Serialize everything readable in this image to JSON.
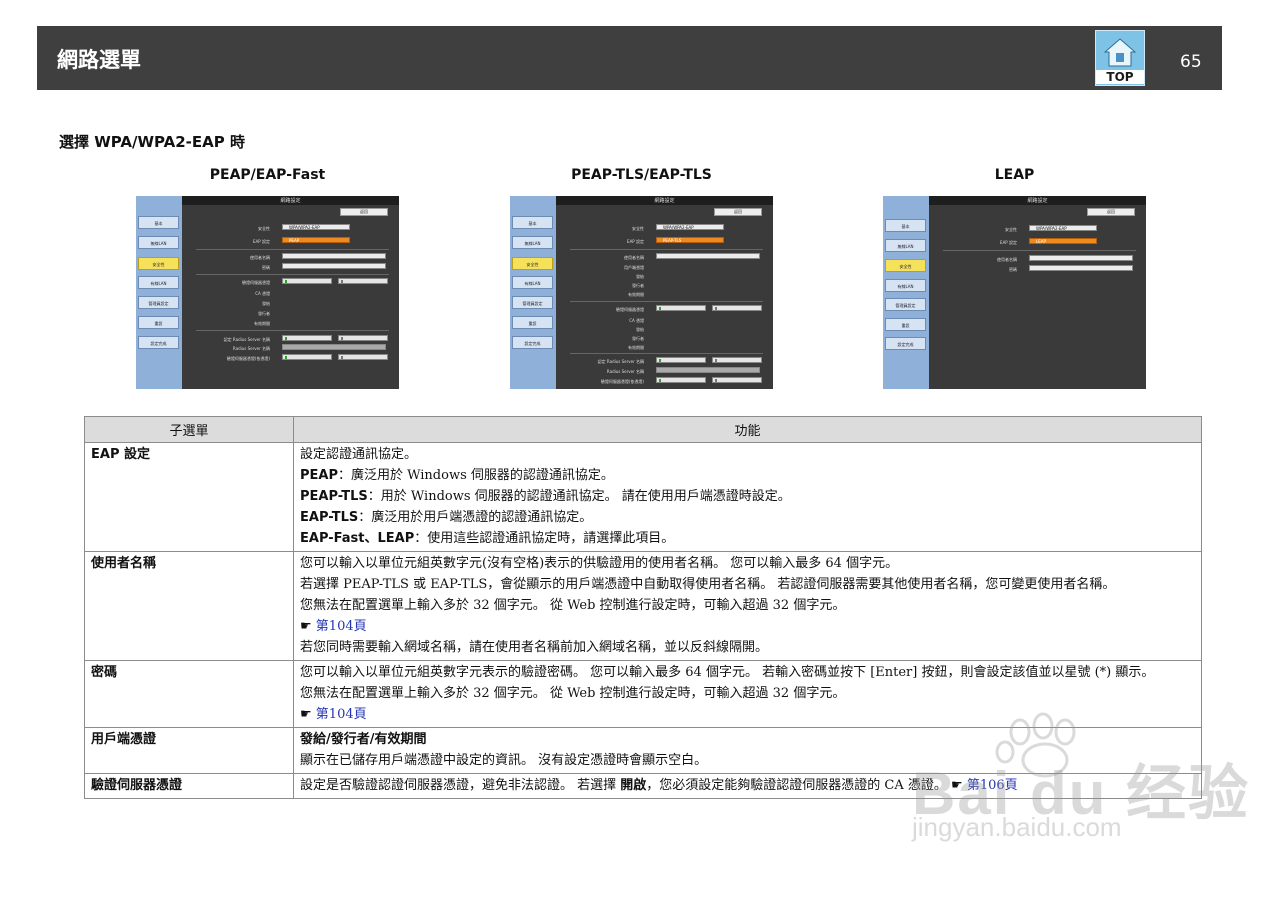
{
  "header": {
    "title": "網路選單",
    "top_label": "TOP",
    "page_number": "65"
  },
  "section_title": "選擇 WPA/WPA2-EAP 時",
  "screenshots": [
    {
      "caption": "PEAP/EAP-Fast",
      "window_title": "網路設定",
      "return": "返回",
      "sidebar": [
        "基本",
        "無線LAN",
        "安全性",
        "有線LAN",
        "管理員設定",
        "重設",
        "設定完成"
      ],
      "security_label": "安全性",
      "security_value": "WPA/WPA2-EAP",
      "eap_label": "EAP 設定",
      "eap_value": "PEAP",
      "fields": [
        "使用者名稱",
        "密碼",
        "驗證伺服器憑證",
        "CA 憑證",
        "發給",
        "發行者",
        "有效期間"
      ],
      "radius": [
        "認定 Radius Server 名稱",
        "Radius Server 名稱",
        "驗證伺服器憑證(依憑證)"
      ]
    },
    {
      "caption": "PEAP-TLS/EAP-TLS",
      "window_title": "網路設定",
      "return": "返回",
      "sidebar": [
        "基本",
        "無線LAN",
        "安全性",
        "有線LAN",
        "管理員設定",
        "重設",
        "設定完成"
      ],
      "security_label": "安全性",
      "security_value": "WPA/WPA2-EAP",
      "eap_label": "EAP 設定",
      "eap_value": "PEAP-TLS",
      "fields": [
        "使用者名稱",
        "用戶端憑證",
        "發給",
        "發行者",
        "有效期間",
        "驗證伺服器憑證",
        "CA 憑證",
        "發給",
        "發行者",
        "有效期間"
      ],
      "radius": [
        "認定 Radius Server 名稱",
        "Radius Server 名稱",
        "驗證伺服器憑證(依憑證)"
      ]
    },
    {
      "caption": "LEAP",
      "window_title": "網路設定",
      "return": "返回",
      "sidebar": [
        "基本",
        "無線LAN",
        "安全性",
        "有線LAN",
        "管理員設定",
        "重設",
        "設定完成"
      ],
      "security_label": "安全性",
      "security_value": "WPA/WPA2-EAP",
      "eap_label": "EAP 設定",
      "eap_value": "LEAP",
      "fields": [
        "使用者名稱",
        "密碼"
      ]
    }
  ],
  "table": {
    "headers": [
      "子選單",
      "功能"
    ],
    "rows": [
      {
        "key": "EAP 設定",
        "lines": [
          {
            "text": "設定認證通訊協定。"
          },
          {
            "bold": "PEAP",
            "text": "：廣泛用於 Windows 伺服器的認證通訊協定。"
          },
          {
            "bold": "PEAP-TLS",
            "text": "：用於 Windows 伺服器的認證通訊協定。 請在使用用戶端憑證時設定。"
          },
          {
            "bold": "EAP-TLS",
            "text": "：廣泛用於用戶端憑證的認證通訊協定。"
          },
          {
            "bold": "EAP-Fast、LEAP",
            "text": "：使用這些認證通訊協定時，請選擇此項目。"
          }
        ]
      },
      {
        "key": "使用者名稱",
        "lines": [
          {
            "text": "您可以輸入以單位元組英數字元(沒有空格)表示的供驗證用的使用者名稱。 您可以輸入最多 64 個字元。"
          },
          {
            "text": "若選擇 PEAP-TLS 或 EAP-TLS，會從顯示的用戶端憑證中自動取得使用者名稱。 若認證伺服器需要其他使用者名稱，您可變更使用者名稱。"
          },
          {
            "text": "您無法在配置選單上輸入多於 32 個字元。 從 Web 控制進行設定時，可輸入超過 32 個字元。"
          },
          {
            "hand": "☛",
            "link": "第104頁"
          },
          {
            "text": "若您同時需要輸入網域名稱，請在使用者名稱前加入網域名稱，並以反斜線隔開。"
          }
        ]
      },
      {
        "key": "密碼",
        "lines": [
          {
            "text": "您可以輸入以單位元組英數字元表示的驗證密碼。 您可以輸入最多 64 個字元。 若輸入密碼並按下 [Enter] 按鈕，則會設定該值並以星號 (*) 顯示。"
          },
          {
            "text": "您無法在配置選單上輸入多於 32 個字元。 從 Web 控制進行設定時，可輸入超過 32 個字元。"
          },
          {
            "hand": "☛",
            "link": "第104頁"
          }
        ]
      },
      {
        "key": "用戶端憑證",
        "lines": [
          {
            "bold": "發給/發行者/有效期間",
            "text": ""
          },
          {
            "text": "顯示在已儲存用戶端憑證中設定的資訊。 沒有設定憑證時會顯示空白。"
          }
        ]
      },
      {
        "key": "驗證伺服器憑證",
        "lines": [
          {
            "text": "設定是否驗證認證伺服器憑證，避免非法認證。 若選擇 ",
            "bold2": "開啟",
            "text2": "，您必須設定能夠驗證認證伺服器憑證的 CA 憑證。 ",
            "hand": "☛",
            "link": "第106頁"
          }
        ]
      }
    ]
  },
  "watermark": {
    "text": "Bai du 经验",
    "sub": "jingyan.baidu.com"
  }
}
